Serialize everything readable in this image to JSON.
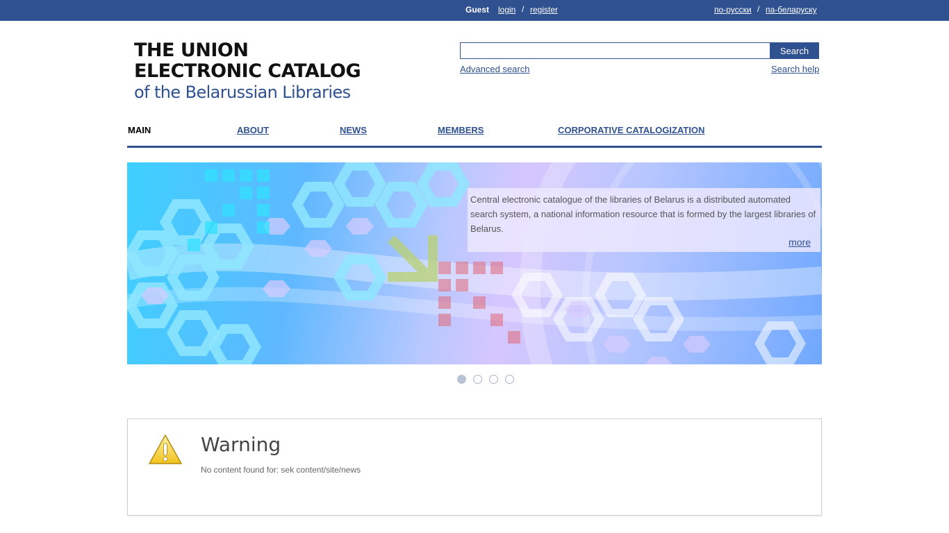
{
  "topbar": {
    "guest": "Guest",
    "login": "login",
    "separator": "/",
    "register": "register",
    "lang_ru": "по-русски",
    "lang_by": "па-беларуску"
  },
  "logo": {
    "line1": "THE UNION",
    "line2": "ELECTRONIC CATALOG",
    "line3": "of the Belarussian Libraries"
  },
  "search": {
    "value": "",
    "button": "Search",
    "advanced": "Advanced search",
    "help": "Search help"
  },
  "nav": {
    "items": [
      {
        "label": "MAIN",
        "active": true
      },
      {
        "label": "ABOUT"
      },
      {
        "label": "NEWS"
      },
      {
        "label": "MEMBERS"
      },
      {
        "label": "CORPORATIVE CATALOGIZATION"
      }
    ]
  },
  "banner": {
    "text": "Central electronic catalogue of the libraries of Belarus is a distributed automated search system, a national information resource that is formed by the largest libraries of Belarus.",
    "more": "more",
    "slides_total": 4,
    "active_slide": 1
  },
  "warning": {
    "title": "Warning",
    "message": "No content found for: sek content/site/news"
  },
  "colors": {
    "brand": "#2f5190",
    "warning_icon": "#f4c430"
  }
}
